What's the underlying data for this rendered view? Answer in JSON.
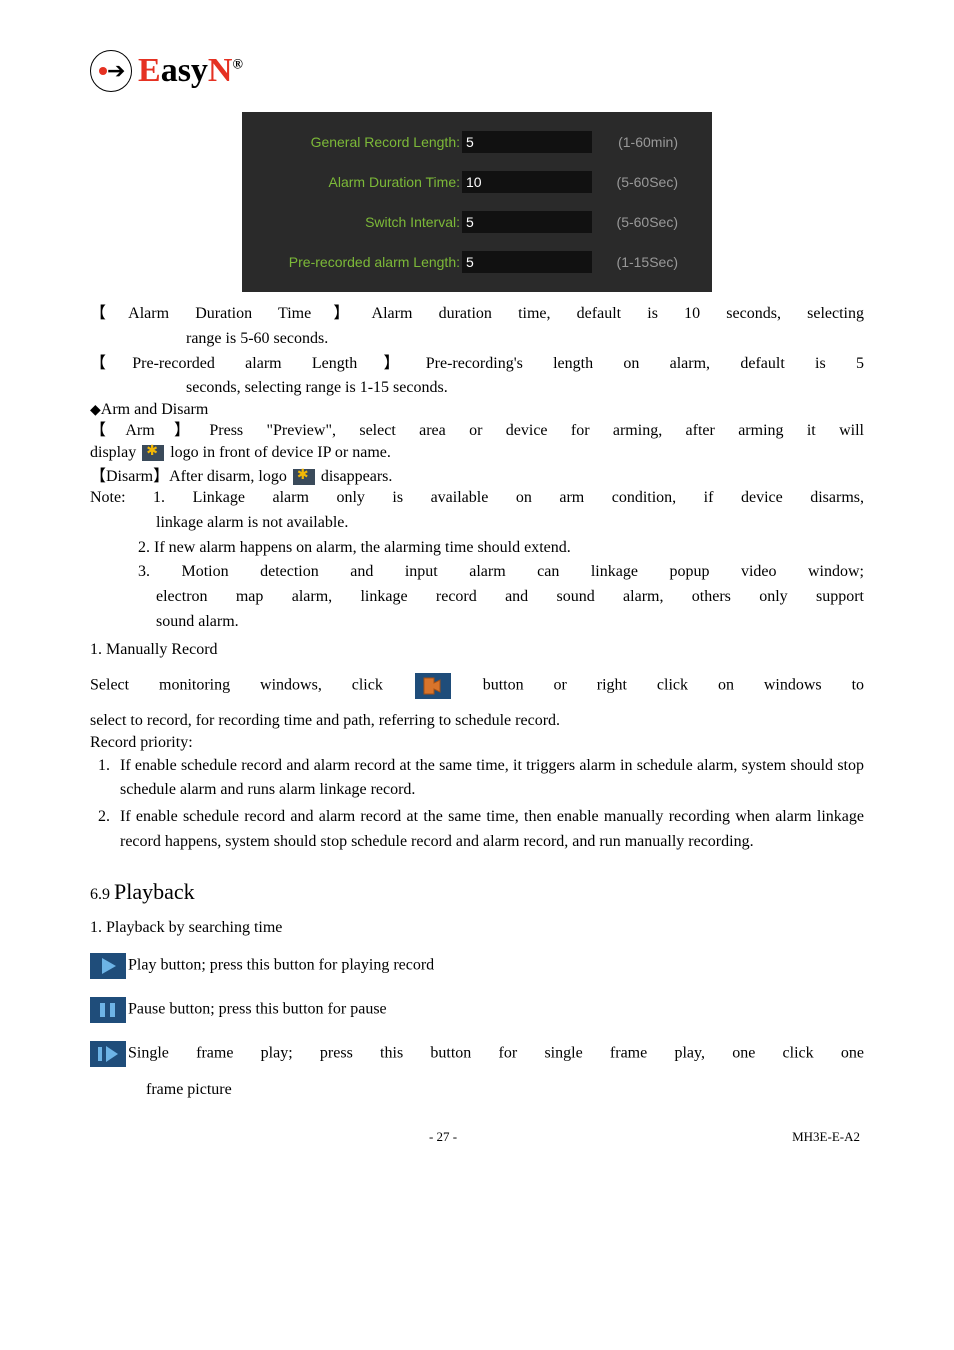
{
  "logo": {
    "brand": "EasyN",
    "reg": "®"
  },
  "settings_panel": {
    "rows": [
      {
        "label": "General Record Length:",
        "value": "5",
        "range": "(1-60min)"
      },
      {
        "label": "Alarm Duration Time:",
        "value": "10",
        "range": "(5-60Sec)"
      },
      {
        "label": "Switch Interval:",
        "value": "5",
        "range": "(5-60Sec)"
      },
      {
        "label": "Pre-recorded alarm Length:",
        "value": "5",
        "range": "(1-15Sec)"
      }
    ]
  },
  "para": {
    "alarm_dur_line1": "【Alarm Duration Time】Alarm duration time, default is 10 seconds, selecting",
    "alarm_dur_line2": "range is 5-60 seconds.",
    "pre_rec_line1": "【Pre-recorded alarm Length】Pre-recording's length on alarm, default is 5",
    "pre_rec_line2": "seconds, selecting range is 1-15 seconds.",
    "arm_disarm_heading": "Arm and Disarm",
    "arm_line1": "【Arm】Press \"Preview\", select area or device for arming, after arming it will",
    "arm_line2a": "display ",
    "arm_line2b": " logo in front of device IP or name.",
    "disarm_a": "【Disarm】After disarm, logo ",
    "disarm_b": " disappears.",
    "note1a": "Note: 1. Linkage alarm only is available on arm condition, if device disarms,",
    "note1b": "linkage alarm is not available.",
    "note2": "2. If new alarm happens on alarm, the alarming time should extend.",
    "note3a": "3. Motion detection and input alarm can linkage popup video window;",
    "note3b": "electron map alarm, linkage record and sound alarm, others only support",
    "note3c": "sound alarm.",
    "man_rec_heading": "1. Manually Record",
    "man_rec_a": "Select monitoring windows, click ",
    "man_rec_b": " button or right click on windows to",
    "man_rec_c": "select to record, for recording time and path, referring to schedule record.",
    "rec_priority_label": "Record priority:",
    "priority1": "If enable schedule record and alarm record at the same time, it triggers alarm in schedule alarm, system should stop schedule alarm and runs alarm linkage record.",
    "priority2": "If enable schedule record and alarm record at the same time, then enable manually recording when alarm linkage record happens, system should stop schedule record and alarm record, and run manually recording."
  },
  "section": {
    "num": "6.9 ",
    "title": "Playback"
  },
  "playback": {
    "sub1": "1. Playback by searching time",
    "play": "Play button; press this button for playing record",
    "pause": "Pause button; press this button for pause",
    "frame_a": "Single frame play; press this button for single frame play, one click one",
    "frame_b": "frame picture"
  },
  "footer": {
    "page": "- 27 -",
    "doc": "MH3E-E-A2"
  }
}
